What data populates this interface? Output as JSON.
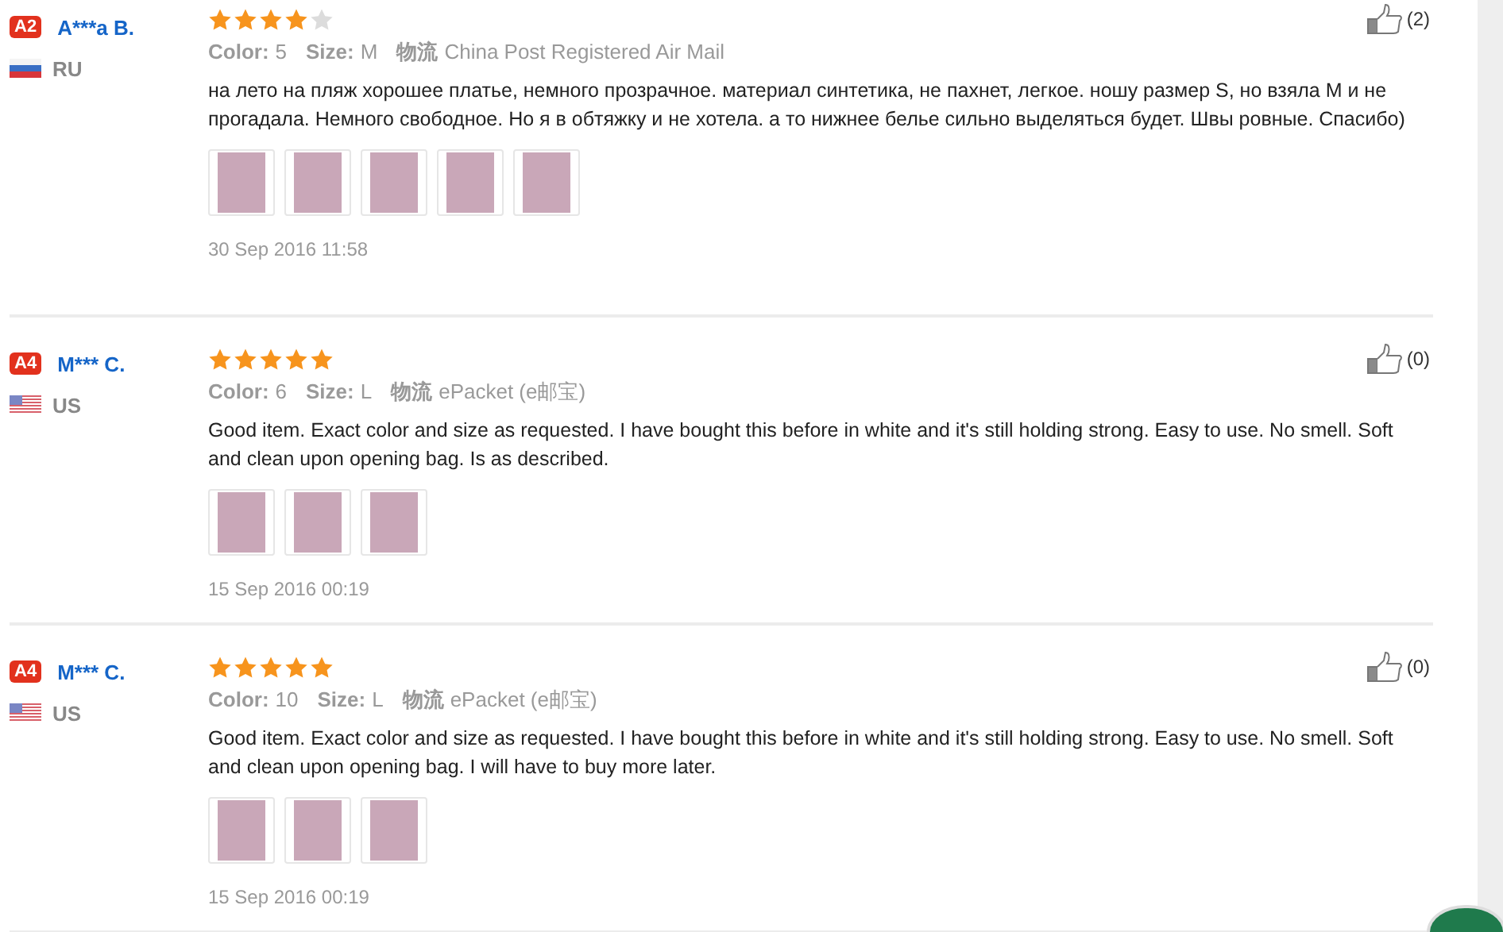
{
  "reviews": [
    {
      "level_badge": "A2",
      "name": "A***a B.",
      "flag": {
        "kind": "ru"
      },
      "country": "RU",
      "stars": 4,
      "color_label": "Color:",
      "color_value": "5",
      "size_label": "Size:",
      "size_value": "M",
      "shipping_label": "物流",
      "shipping_value": "China Post Registered Air Mail",
      "text": "на лето на пляж хорошее платье, немного прозрачное. материал синтетика, не пахнет, легкое. ношу размер S, но взяла M и не прогадала. Немного свободное. Но я в обтяжку и не хотела. а то нижнее белье сильно выделяться будет. Швы ровные. Спасибо)",
      "photos": [
        {
          "kind": "photo"
        },
        {
          "kind": "photo"
        },
        {
          "kind": "photo"
        },
        {
          "kind": "photo"
        },
        {
          "kind": "photo"
        }
      ],
      "date": "30 Sep 2016 11:58",
      "helpful": "(2)"
    },
    {
      "level_badge": "A4",
      "name": "M*** C.",
      "flag": {
        "kind": "us"
      },
      "country": "US",
      "stars": 5,
      "color_label": "Color:",
      "color_value": "6",
      "size_label": "Size:",
      "size_value": "L",
      "shipping_label": "物流",
      "shipping_value": "ePacket (e邮宝)",
      "text": "Good item. Exact color and size as requested. I have bought this before in white and it's still holding strong. Easy to use. No smell. Soft and clean upon opening bag. Is as described.",
      "photos": [
        {
          "kind": "photo"
        },
        {
          "kind": "photo"
        },
        {
          "kind": "photo"
        }
      ],
      "date": "15 Sep 2016 00:19",
      "helpful": "(0)"
    },
    {
      "level_badge": "A4",
      "name": "M*** C.",
      "flag": {
        "kind": "us"
      },
      "country": "US",
      "stars": 5,
      "color_label": "Color:",
      "color_value": "10",
      "size_label": "Size:",
      "size_value": "L",
      "shipping_label": "物流",
      "shipping_value": "ePacket (e邮宝)",
      "text": "Good item. Exact color and size as requested. I have bought this before in white and it's still holding strong. Easy to use. No smell. Soft and clean upon opening bag. I will have to buy more later.",
      "photos": [
        {
          "kind": "photo"
        },
        {
          "kind": "photo"
        },
        {
          "kind": "photo"
        }
      ],
      "date": "15 Sep 2016 00:19",
      "helpful": "(0)"
    }
  ]
}
